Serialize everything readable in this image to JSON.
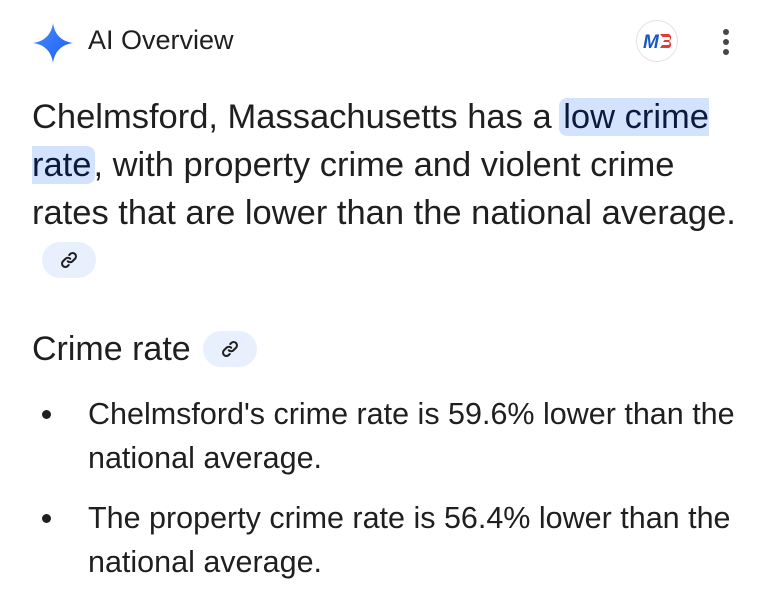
{
  "header": {
    "title": "AI Overview",
    "logo_icon": "sparkle-icon",
    "source_logo_text": "M",
    "menu_icon": "more-vert-icon"
  },
  "summary": {
    "text_before": "Chelmsford, Massachusetts has a ",
    "highlight": "low crime rate",
    "text_after": ", with property crime and violent crime rates that are lower than the national average.",
    "citation_icon": "link-icon"
  },
  "section": {
    "title": "Crime rate",
    "citation_icon": "link-icon"
  },
  "bullets": [
    "Chelmsford's crime rate is 59.6% lower than the national average.",
    "The property crime rate is 56.4% lower than the national average."
  ],
  "colors": {
    "accent": "#1a73e8",
    "highlight_bg": "#d3e3fd",
    "chip_bg": "#e8f0fe",
    "text": "#1f1f1f"
  }
}
